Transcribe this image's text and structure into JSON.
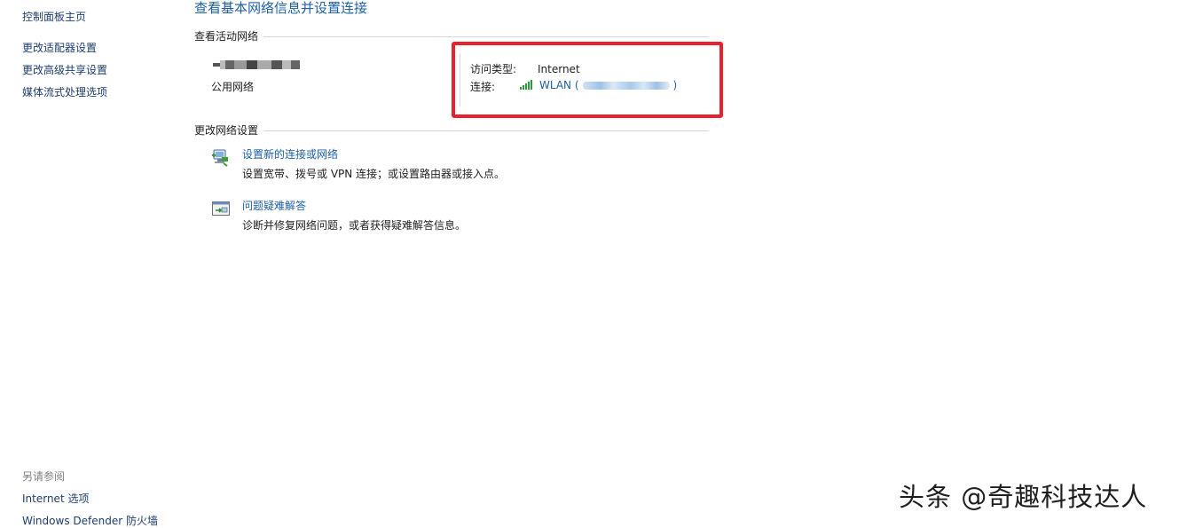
{
  "sidebar": {
    "home": "控制面板主页",
    "items": [
      {
        "label": "更改适配器设置"
      },
      {
        "label": "更改高级共享设置"
      },
      {
        "label": "媒体流式处理选项"
      }
    ],
    "see_also_caption": "另请参阅",
    "see_also": [
      {
        "label": "Internet 选项"
      },
      {
        "label": "Windows Defender 防火墙"
      }
    ]
  },
  "main": {
    "title": "查看基本网络信息并设置连接",
    "active_networks_header": "查看活动网络",
    "network": {
      "type_label": "公用网络",
      "access_type_key": "访问类型:",
      "access_type_value": "Internet",
      "connection_key": "连接:",
      "connection_open": "WLAN (",
      "connection_close": ")"
    },
    "change_settings_header": "更改网络设置",
    "tasks": [
      {
        "title": "设置新的连接或网络",
        "desc": "设置宽带、拨号或 VPN 连接；或设置路由器或接入点。",
        "icon": "network-setup-icon"
      },
      {
        "title": "问题疑难解答",
        "desc": "诊断并修复网络问题，或者获得疑难解答信息。",
        "icon": "troubleshoot-icon"
      }
    ]
  },
  "colors": {
    "link": "#1e5fa8",
    "highlight": "#e8212e",
    "signal": "#2a9a3a"
  },
  "watermark": "头条 @奇趣科技达人"
}
